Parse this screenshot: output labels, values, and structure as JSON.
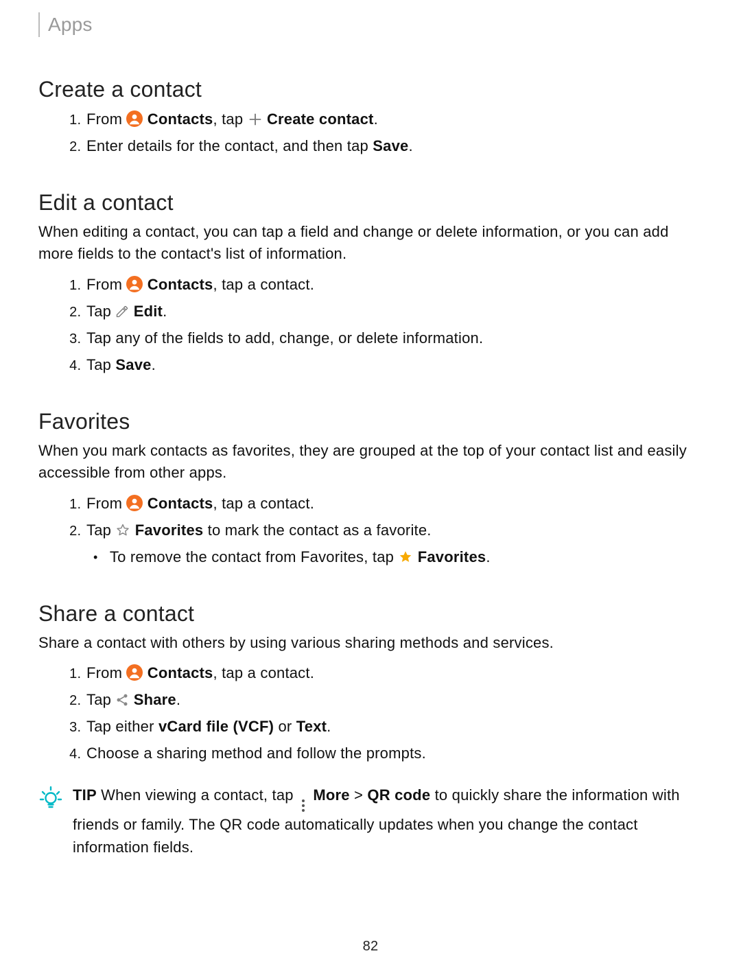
{
  "breadcrumb": "Apps",
  "page_number": "82",
  "labels": {
    "contacts": "Contacts",
    "create_contact": "Create contact",
    "save": "Save",
    "edit": "Edit",
    "favorites": "Favorites",
    "share": "Share",
    "vcf": "vCard file (VCF)",
    "text": "Text",
    "tip": "TIP",
    "more": "More",
    "qr_code": "QR code"
  },
  "sections": {
    "create": {
      "heading": "Create a contact",
      "step1_a": "From ",
      "step1_b": ", tap ",
      "step1_c": ".",
      "step2_a": "Enter details for the contact, and then tap ",
      "step2_b": "."
    },
    "edit": {
      "heading": "Edit a contact",
      "lead": "When editing a contact, you can tap a field and change or delete information, or you can add more fields to the contact's list of information.",
      "step1_a": "From ",
      "step1_b": ", tap a contact.",
      "step2_a": "Tap ",
      "step2_b": ".",
      "step3": "Tap any of the fields to add, change, or delete information.",
      "step4_a": "Tap ",
      "step4_b": "."
    },
    "favorites": {
      "heading": "Favorites",
      "lead": "When you mark contacts as favorites, they are grouped at the top of your contact list and easily accessible from other apps.",
      "step1_a": "From ",
      "step1_b": ", tap a contact.",
      "step2_a": "Tap ",
      "step2_b": " to mark the contact as a favorite.",
      "sub_a": "To remove the contact from Favorites, tap ",
      "sub_b": "."
    },
    "share": {
      "heading": "Share a contact",
      "lead": "Share a contact with others by using various sharing methods and services.",
      "step1_a": "From ",
      "step1_b": ", tap a contact.",
      "step2_a": "Tap ",
      "step2_b": ".",
      "step3_a": "Tap either ",
      "step3_b": " or ",
      "step3_c": ".",
      "step4": "Choose a sharing method and follow the prompts."
    },
    "tip": {
      "text_a": "  When viewing a contact, tap ",
      "text_b": " > ",
      "text_c": " to quickly share the information with friends or family. The QR code automatically updates when you change the contact information fields."
    }
  },
  "colors": {
    "accent": "#f36f21",
    "star": "#f7a900",
    "tip": "#00b9c6"
  }
}
